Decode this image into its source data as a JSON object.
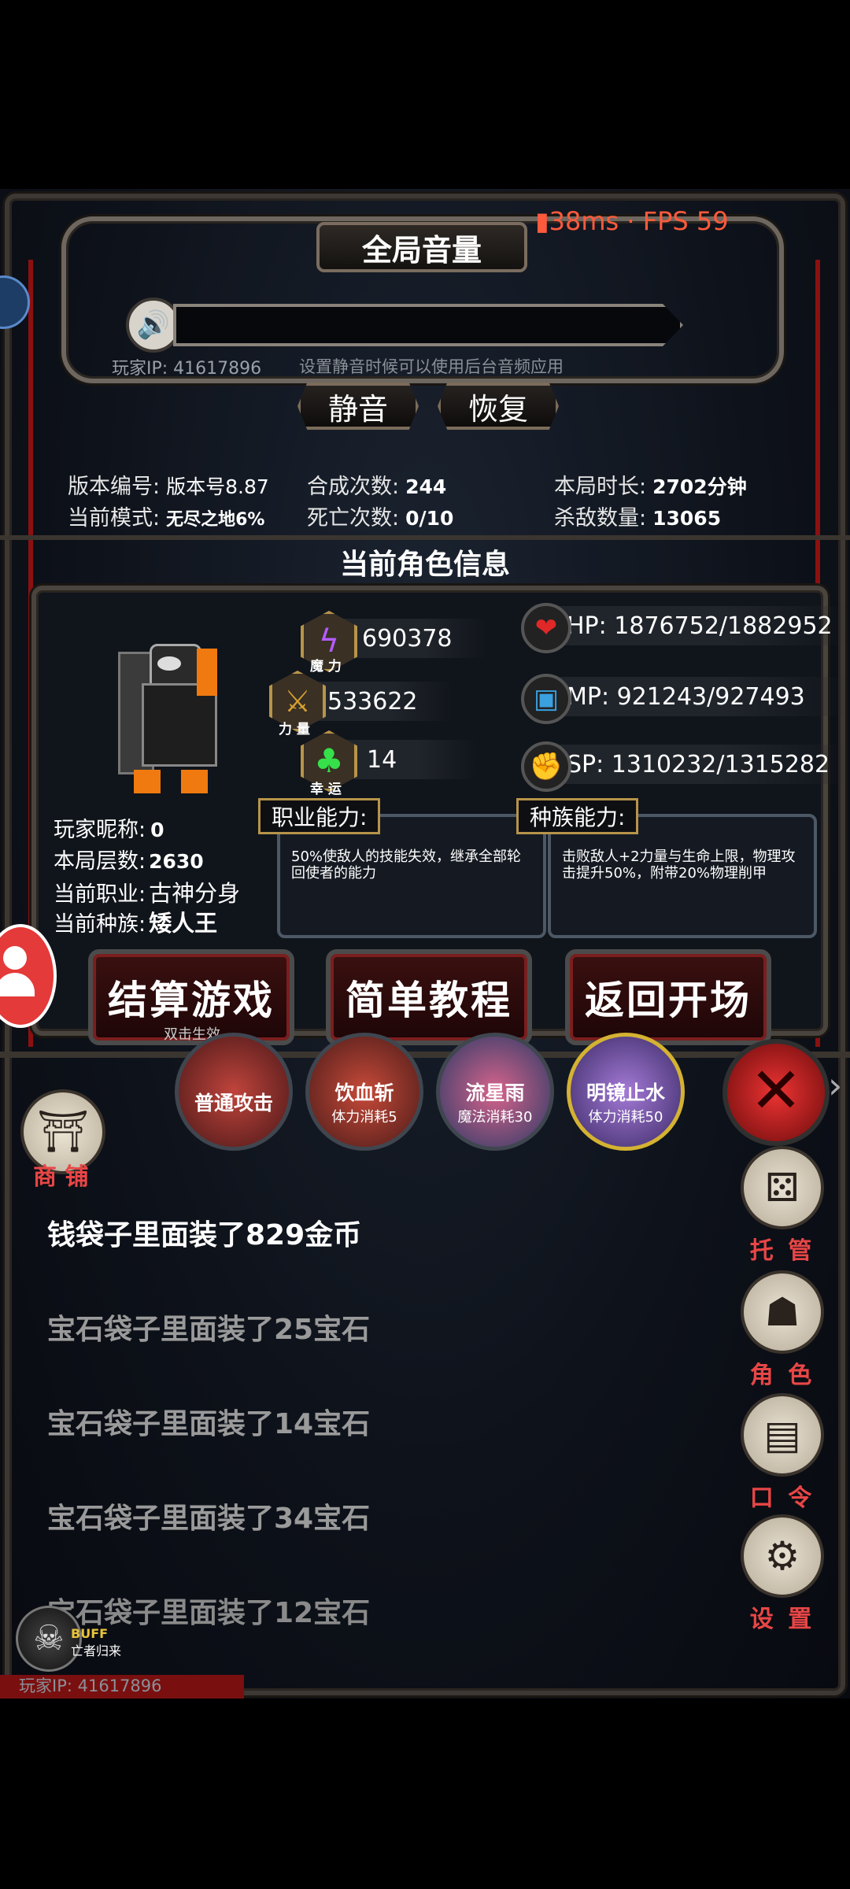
{
  "net": {
    "ping": "38ms · FPS 59"
  },
  "volume": {
    "title": "全局音量",
    "player_ip": "玩家IP: 41617896",
    "hint": "设置静音时候可以使用后台音频应用",
    "mute": "静音",
    "restore": "恢复"
  },
  "stats": {
    "version_label": "版本编号:",
    "version_value": "版本号8.87",
    "mode_label": "当前模式:",
    "mode_value": "无尽之地6%",
    "craft_label": "合成次数:",
    "craft_value": "244",
    "death_label": "死亡次数:",
    "death_value": "0/10",
    "time_label": "本局时长:",
    "time_value": "2702分钟",
    "kill_label": "杀敌数量:",
    "kill_value": "13065"
  },
  "character": {
    "section_title": "当前角色信息",
    "magic": "690378",
    "magic_label": "魔 力",
    "power": "533622",
    "power_label": "力 量",
    "luck": "14",
    "luck_label": "幸 运",
    "hp": "HP:  1876752/1882952",
    "mp": "MP:  921243/927493",
    "sp": "SP:  1310232/1315282",
    "nickname_label": "玩家昵称:",
    "nickname": "0",
    "floor_label": "本局层数:",
    "floor": "2630",
    "job_label": "当前职业:",
    "job": "古神分身",
    "race_label": "当前种族:",
    "race": "矮人王",
    "job_ability_tag": "职业能力:",
    "job_ability": "50%使敌人的技能失效，继承全部轮回使者的能力",
    "race_ability_tag": "种族能力:",
    "race_ability": "击败敌人+2力量与生命上限，物理攻击提升50%，附带20%物理削甲"
  },
  "buttons": {
    "settle": "结算游戏",
    "settle_hint": "双击生效",
    "tutorial": "简单教程",
    "back": "返回开场"
  },
  "skills": [
    {
      "name": "普通攻击",
      "cost": ""
    },
    {
      "name": "饮血斩",
      "cost": "体力消耗5"
    },
    {
      "name": "流星雨",
      "cost": "魔法消耗30"
    },
    {
      "name": "明镜止水",
      "cost": "体力消耗50"
    }
  ],
  "shop": {
    "label": "商 铺"
  },
  "side": [
    {
      "label": "托 管",
      "icon": "dice-icon"
    },
    {
      "label": "角 色",
      "icon": "hood-icon"
    },
    {
      "label": "口 令",
      "icon": "book-icon"
    },
    {
      "label": "设 置",
      "icon": "gear-icon"
    }
  ],
  "logs": [
    "钱袋子里面装了829金币",
    "宝石袋子里面装了25宝石",
    "宝石袋子里面装了14宝石",
    "宝石袋子里面装了34宝石",
    "宝石袋子里面装了12宝石"
  ],
  "buff": {
    "title": "BUFF",
    "name": "亡者归来"
  },
  "footer_ip": "玩家IP: 41617896",
  "colors": {
    "accent_red": "#e84646",
    "gold": "#b7944a",
    "ping_red": "#ff5a3c",
    "fps_green": "#5adf5a"
  }
}
